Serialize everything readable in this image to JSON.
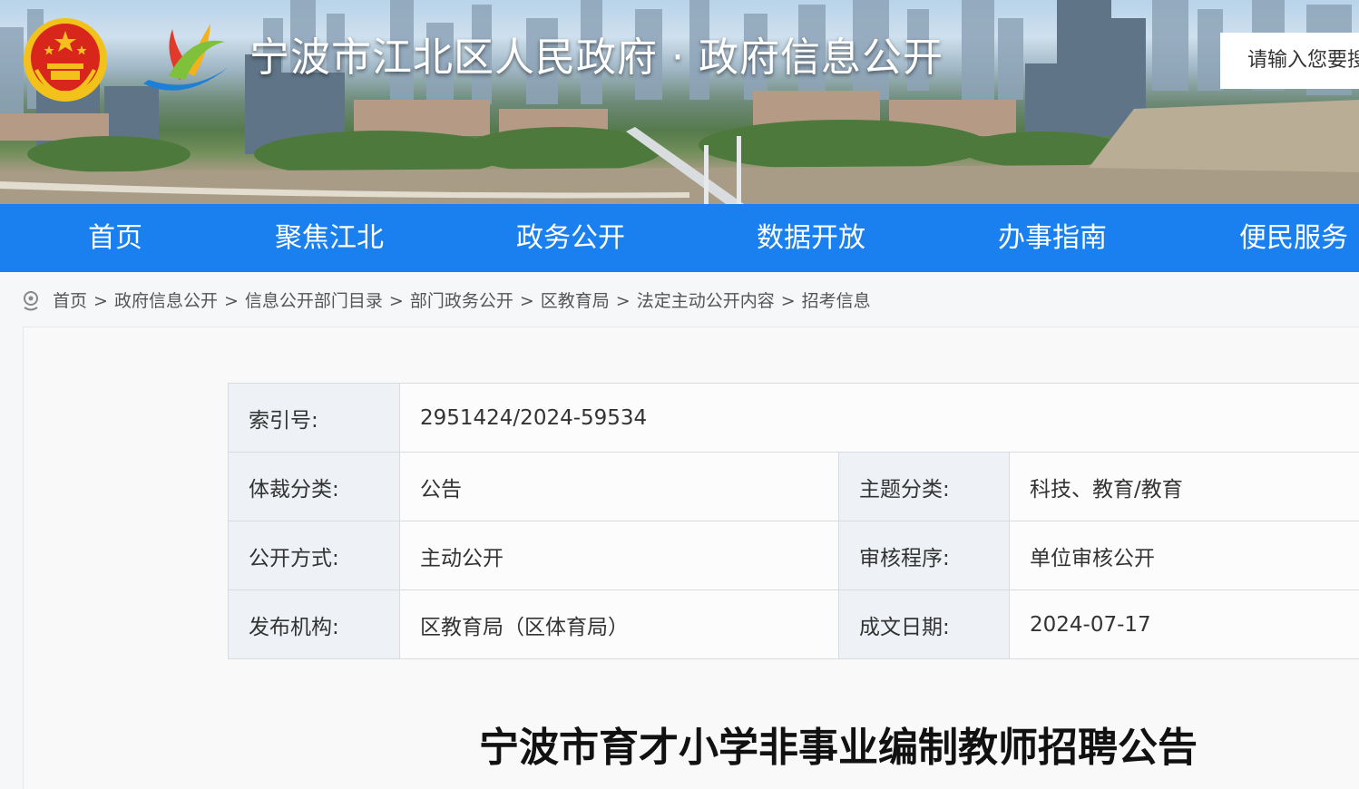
{
  "header": {
    "site_title": "宁波市江北区人民政府 · 政府信息公开",
    "search_placeholder": "请输入您要搜索的内容"
  },
  "nav": {
    "items": [
      "首页",
      "聚焦江北",
      "政务公开",
      "数据开放",
      "办事指南",
      "便民服务"
    ]
  },
  "breadcrumb": {
    "items": [
      "首页",
      "政府信息公开",
      "信息公开部门目录",
      "部门政务公开",
      "区教育局",
      "法定主动公开内容",
      "招考信息"
    ],
    "separator": ">"
  },
  "meta": {
    "index_label": "索引号:",
    "index_value": "2951424/2024-59534",
    "genre_label": "体裁分类:",
    "genre_value": "公告",
    "topic_label": "主题分类:",
    "topic_value": "科技、教育/教育",
    "method_label": "公开方式:",
    "method_value": "主动公开",
    "review_label": "审核程序:",
    "review_value": "单位审核公开",
    "publisher_label": "发布机构:",
    "publisher_value": "区教育局（区体育局）",
    "date_label": "成文日期:",
    "date_value": "2024-07-17"
  },
  "article": {
    "title": "宁波市育才小学非事业编制教师招聘公告"
  },
  "colors": {
    "nav_bg": "#1a80f0",
    "emblem_red": "#d8261c",
    "emblem_gold": "#f2c21a"
  }
}
